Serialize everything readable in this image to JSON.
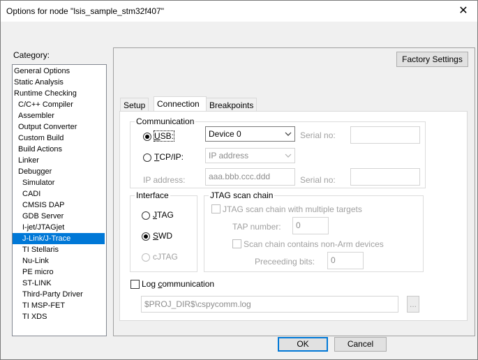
{
  "window": {
    "title": "Options for node \"lsis_sample_stm32f407\"",
    "close_glyph": "✕"
  },
  "category": {
    "label": "Category:",
    "items": [
      {
        "label": "General Options",
        "indent": 0
      },
      {
        "label": "Static Analysis",
        "indent": 0
      },
      {
        "label": "Runtime Checking",
        "indent": 0
      },
      {
        "label": "C/C++ Compiler",
        "indent": 1
      },
      {
        "label": "Assembler",
        "indent": 1
      },
      {
        "label": "Output Converter",
        "indent": 1
      },
      {
        "label": "Custom Build",
        "indent": 1
      },
      {
        "label": "Build Actions",
        "indent": 1
      },
      {
        "label": "Linker",
        "indent": 1
      },
      {
        "label": "Debugger",
        "indent": 1
      },
      {
        "label": "Simulator",
        "indent": 2
      },
      {
        "label": "CADI",
        "indent": 2
      },
      {
        "label": "CMSIS DAP",
        "indent": 2
      },
      {
        "label": "GDB Server",
        "indent": 2
      },
      {
        "label": "I-jet/JTAGjet",
        "indent": 2
      },
      {
        "label": "J-Link/J-Trace",
        "indent": 2,
        "selected": true
      },
      {
        "label": "TI Stellaris",
        "indent": 2
      },
      {
        "label": "Nu-Link",
        "indent": 2
      },
      {
        "label": "PE micro",
        "indent": 2
      },
      {
        "label": "ST-LINK",
        "indent": 2
      },
      {
        "label": "Third-Party Driver",
        "indent": 2
      },
      {
        "label": "TI MSP-FET",
        "indent": 2
      },
      {
        "label": "TI XDS",
        "indent": 2
      }
    ]
  },
  "factory_settings": "Factory Settings",
  "tabs": [
    "Setup",
    "Connection",
    "Breakpoints"
  ],
  "communication": {
    "title": "Communication",
    "usb_label": "USB:",
    "usb_device": "Device 0",
    "serial_no_label": "Serial no:",
    "tcpip_label": "TCP/IP:",
    "tcpip_placeholder": "IP address",
    "ip_address_label": "IP address:",
    "ip_address_value": "aaa.bbb.ccc.ddd",
    "serial_no_label2": "Serial no:"
  },
  "interface": {
    "title": "Interface",
    "jtag": "JTAG",
    "swd": "SWD",
    "cjtag": "cJTAG"
  },
  "jtag_chain": {
    "title": "JTAG scan chain",
    "multi_targets": "JTAG scan chain with multiple targets",
    "tap_label": "TAP number:",
    "tap_value": "0",
    "non_arm": "Scan chain contains non-Arm devices",
    "preceding_label": "Preceeding bits:",
    "preceding_value": "0"
  },
  "log": {
    "label": "Log communication",
    "path": "$PROJ_DIR$\\cspycomm.log",
    "browse": "..."
  },
  "buttons": {
    "ok": "OK",
    "cancel": "Cancel"
  },
  "icons": {
    "dropdown": "chevron-down-icon",
    "close": "close-icon"
  }
}
